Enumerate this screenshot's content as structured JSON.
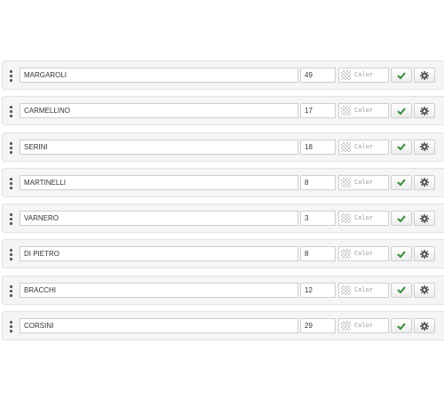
{
  "rows": [
    {
      "name": "MARGAROLI",
      "number": "49",
      "color_placeholder": "Color"
    },
    {
      "name": "CARMELLINO",
      "number": "17",
      "color_placeholder": "Color"
    },
    {
      "name": "SERINI",
      "number": "18",
      "color_placeholder": "Color"
    },
    {
      "name": "MARTINELLI",
      "number": "8",
      "color_placeholder": "Color"
    },
    {
      "name": "VARNERO",
      "number": "3",
      "color_placeholder": "Color"
    },
    {
      "name": "DI PIETRO",
      "number": "8",
      "color_placeholder": "Color"
    },
    {
      "name": "BRACCHI",
      "number": "12",
      "color_placeholder": "Color"
    },
    {
      "name": "CORSINI",
      "number": "29",
      "color_placeholder": "Color"
    }
  ],
  "icons": {
    "drag": "drag-handle-icon",
    "swatch": "transparent-swatch-icon",
    "confirm": "check-icon",
    "settings": "gear-icon"
  },
  "colors": {
    "confirm_icon": "#3a8a3a",
    "settings_icon": "#555555",
    "row_background": "#f5f5f5"
  }
}
